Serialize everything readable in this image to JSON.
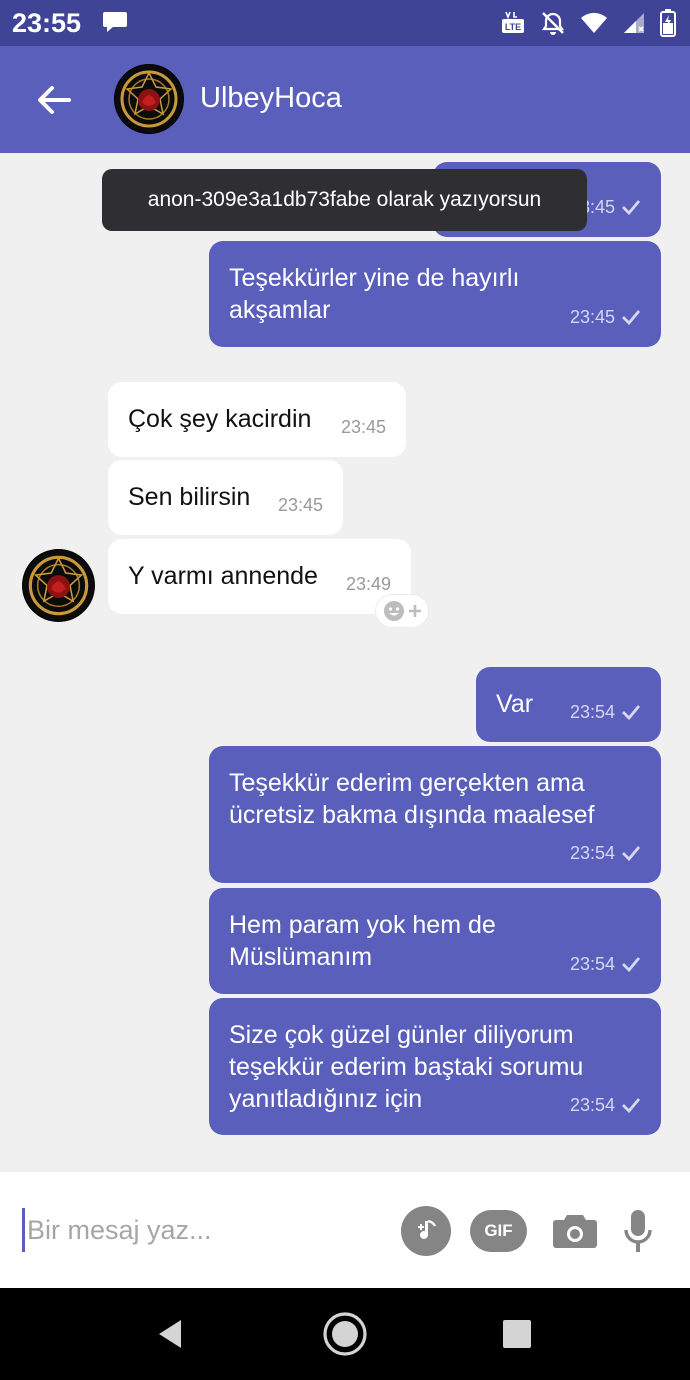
{
  "status_bar": {
    "time": "23:55",
    "icons": [
      "message-notification-icon",
      "volte-icon",
      "alarm-off-icon",
      "wifi-icon",
      "signal-icon",
      "battery-icon"
    ]
  },
  "header": {
    "title": "UlbeyHoca",
    "back_icon": "back-arrow-icon"
  },
  "toast": "anon-309e3a1db73fabe olarak yazıyorsun",
  "messages": [
    {
      "dir": "out",
      "text": "",
      "time": "23:45",
      "read": true
    },
    {
      "dir": "out",
      "text": "Teşekkürler yine de hayırlı akşamlar",
      "time": "23:45",
      "read": true
    },
    {
      "dir": "in",
      "text": "Çok şey kacirdin",
      "time": "23:45"
    },
    {
      "dir": "in",
      "text": "Sen bilirsin",
      "time": "23:45"
    },
    {
      "dir": "in",
      "text": "Y varmı annende",
      "time": "23:49"
    },
    {
      "dir": "out",
      "text": "Var",
      "time": "23:54",
      "read": true
    },
    {
      "dir": "out",
      "text": "Teşekkür ederim gerçekten ama ücretsiz bakma dışında maalesef",
      "time": "23:54",
      "read": true
    },
    {
      "dir": "out",
      "text": "Hem param yok hem de Müslümanım",
      "time": "23:54",
      "read": true
    },
    {
      "dir": "out",
      "text": "Size çok güzel günler diliyorum teşekkür ederim baştaki sorumu yanıtladığınız için",
      "time": "23:54",
      "read": true
    }
  ],
  "input": {
    "placeholder": "Bir mesaj yaz..."
  },
  "input_actions": [
    "music-note-icon",
    "gif-icon",
    "camera-icon",
    "microphone-icon"
  ],
  "gif_label": "GIF",
  "nav": [
    "back-triangle-icon",
    "home-circle-icon",
    "recents-square-icon"
  ],
  "colors": {
    "status_bar": "#3f4497",
    "app_bar": "#5b5fbc",
    "outgoing_bubble": "#5b5fbc",
    "incoming_bubble": "#ffffff",
    "chat_background": "#f0f0f0"
  }
}
